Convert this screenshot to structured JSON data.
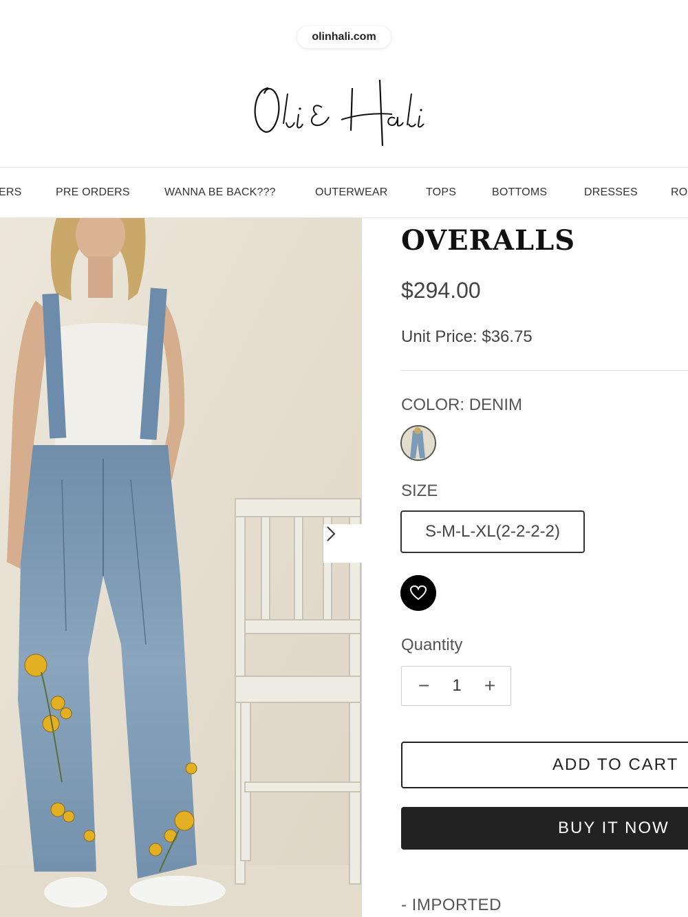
{
  "browser": {
    "url": "olinhali.com"
  },
  "brand": {
    "logo_text": "Oli & Hali"
  },
  "nav": {
    "items": [
      "ERS",
      "PRE ORDERS",
      "WANNA BE BACK???",
      "OUTERWEAR",
      "TOPS",
      "BOTTOMS",
      "DRESSES",
      "RO"
    ]
  },
  "product": {
    "title": "OVERALLS",
    "price": "$294.00",
    "unit_price": "Unit Price: $36.75",
    "color_key": "COLOR:",
    "color_value": "DENIM",
    "size_label": "SIZE",
    "size_option": "S-M-L-XL(2-2-2-2)",
    "quantity_label": "Quantity",
    "quantity_value": "1",
    "qty_minus": "−",
    "qty_plus": "+",
    "add_to_cart": "ADD TO CART",
    "buy_now": "BUY IT NOW",
    "description_line": "- IMPORTED"
  },
  "icons": {
    "next": "chevron-right-icon",
    "wishlist": "heart-icon"
  },
  "colors": {
    "text": "#1a1a1a",
    "muted": "#555555",
    "button_dark": "#222222",
    "denim": "#7d9bb8",
    "background_wall": "#e7e1d3"
  }
}
